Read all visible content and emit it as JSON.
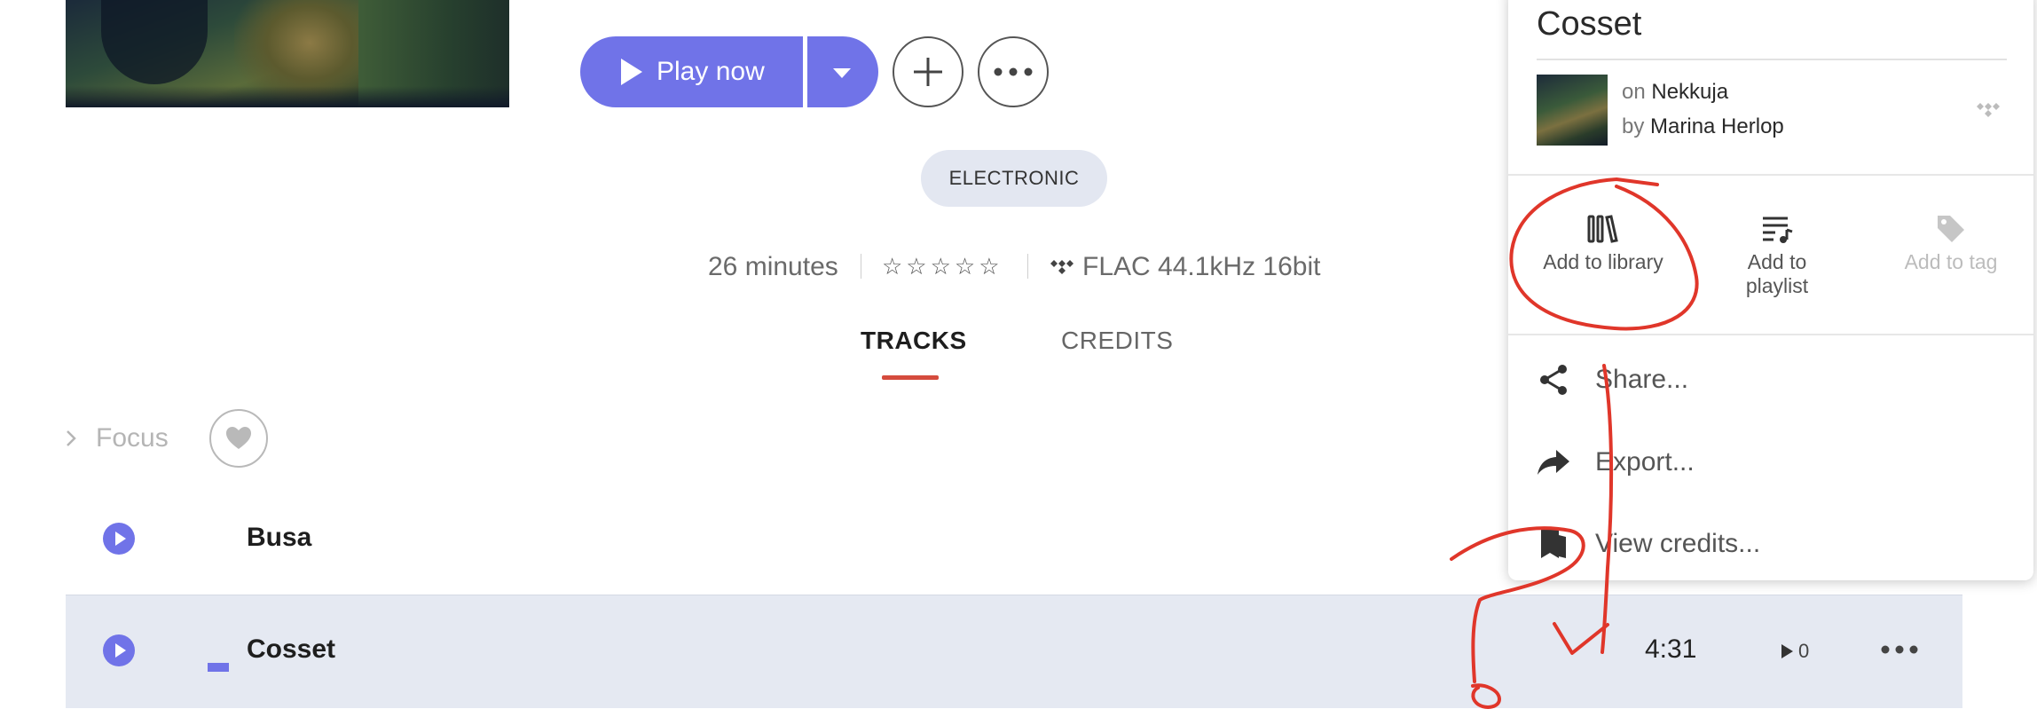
{
  "actions": {
    "play_now_label": "Play now"
  },
  "album": {
    "genre": "ELECTRONIC",
    "duration": "26 minutes",
    "rating_stars": "☆☆☆☆☆",
    "quality": "FLAC 44.1kHz 16bit"
  },
  "tabs": [
    {
      "label": "TRACKS",
      "active": true
    },
    {
      "label": "CREDITS",
      "active": false
    }
  ],
  "focus": {
    "label": "Focus"
  },
  "tracks": [
    {
      "title": "Busa",
      "duration": "",
      "plays": ""
    },
    {
      "title": "Cosset",
      "duration": "4:31",
      "plays": "0",
      "playing": true
    }
  ],
  "context_menu": {
    "title": "Cosset",
    "album_prefix": "on",
    "album": "Nekkuja",
    "artist_prefix": "by",
    "artist": "Marina Herlop",
    "add_to_library": "Add to library",
    "add_to_playlist_line1": "Add to",
    "add_to_playlist_line2": "playlist",
    "add_to_tag": "Add to tag",
    "share": "Share...",
    "export": "Export...",
    "view_credits": "View credits..."
  },
  "colors": {
    "accent": "#7073e8",
    "tab_underline": "#d54b3d",
    "selected_row": "#e5e9f2",
    "annotation_ink": "#e0362a"
  },
  "icons": [
    "play-icon",
    "caret-down-icon",
    "plus-icon",
    "ellipsis-icon",
    "tidal-icon",
    "chevron-right-icon",
    "heart-icon",
    "library-icon",
    "playlist-icon",
    "tag-icon",
    "share-icon",
    "export-icon",
    "credits-icon"
  ]
}
